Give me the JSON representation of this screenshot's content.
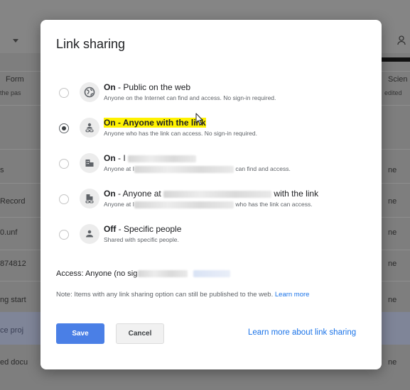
{
  "background": {
    "header_texts": [
      "Form",
      "the pas",
      "Scien",
      "edited"
    ],
    "rows": [
      {
        "left": "s",
        "right": "ne"
      },
      {
        "left": "Record",
        "right": "ne"
      },
      {
        "left": "0.unf",
        "right": "ne"
      },
      {
        "left": "874812",
        "right": "ne"
      },
      {
        "left": "ng start",
        "right": "ne"
      },
      {
        "left": "ce proj",
        "right": ""
      },
      {
        "left": "ed docu",
        "right": "ne"
      }
    ]
  },
  "dialog": {
    "title": "Link sharing",
    "options": [
      {
        "title_bold": "On",
        "title_rest": " - Public on the web",
        "desc": "Anyone on the Internet can find and access. No sign-in required.",
        "icon": "globe-icon",
        "checked": false
      },
      {
        "title_bold": "On - Anyone with the link",
        "title_rest": "",
        "desc": "Anyone who has the link can access. No sign-in required.",
        "icon": "link-person-icon",
        "checked": true
      },
      {
        "title_bold": "On",
        "title_rest": " - I",
        "desc_start": "Anyone at I",
        "desc_end": " can find and access.",
        "icon": "building-icon",
        "checked": false
      },
      {
        "title_bold": "On",
        "title_rest": " - Anyone at",
        "title_end": " with the link",
        "desc_start": "Anyone at I",
        "desc_end": " who has the link can access.",
        "icon": "building-link-icon",
        "checked": false
      },
      {
        "title_bold": "Off",
        "title_rest": " - Specific people",
        "desc": "Shared with specific people.",
        "icon": "people-icon",
        "checked": false
      }
    ],
    "access_label": "Access:  Anyone (no sig",
    "note": "Note: Items with any link sharing option can still be published to the web.",
    "note_link": "Learn more",
    "save_label": "Save",
    "cancel_label": "Cancel",
    "learn_more_sharing": "Learn more about link sharing"
  },
  "colors": {
    "highlight": "#fff200",
    "accent": "#4a7fe6",
    "link": "#1a73e8"
  }
}
